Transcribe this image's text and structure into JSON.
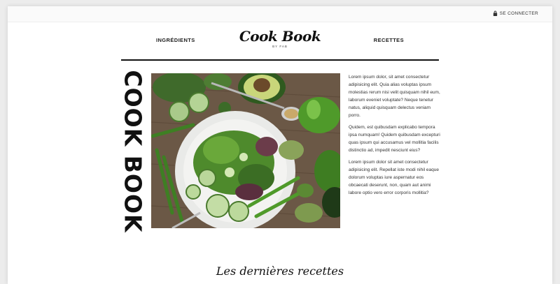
{
  "topbar": {
    "login_label": "SE CONNECTER",
    "login_icon": "lock-icon"
  },
  "nav": {
    "left_label": "INGRÉDIENTS",
    "right_label": "RECETTES",
    "logo_title": "Cook Book",
    "logo_sub": "BY FAB"
  },
  "hero": {
    "vertical_title": "COOK BOOK",
    "image_desc": "salad-bowl-photo"
  },
  "intro": {
    "paragraphs": [
      "Lorem ipsum dolor, sit amet consectetur adipisicing elit. Quia alias voluptas ipsum molestias rerum nisi velit quisquam nihil eum, laborum eveniet voluptate? Neque tenetur natus, aliquid quisquam delectus veniam porro.",
      "Quidem, est quibusdam explicabo tempora ipsa numquam! Quidem quibusdam excepturi quas ipsum qui accusamus vel mollitia facilis distinctio ad, impedit nesciunt eius?",
      "Lorem ipsum dolor sit amet consectetur adipisicing elit. Repellat iste modi nihil eaque dolorum voluptas iure aspernatur eos obcaecati deserunt, non, quam aut animi labore optio vero error corporis mollitia?"
    ]
  },
  "latest": {
    "title": "Les dernières recettes"
  },
  "colors": {
    "accent": "#111111",
    "background": "#ffffff",
    "page_bg": "#ececec"
  }
}
